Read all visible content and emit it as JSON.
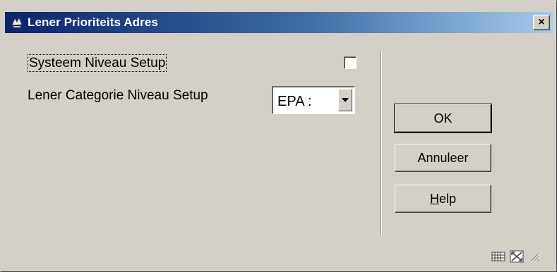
{
  "window": {
    "title": "Lener Prioriteits Adres",
    "close_glyph": "×"
  },
  "form": {
    "system_setup_label": "Systeem Niveau Setup",
    "system_setup_checked": false,
    "category_setup_label": "Lener Categorie Niveau Setup",
    "category_setup_value": "EPA :"
  },
  "buttons": {
    "ok": "OK",
    "cancel": "Annuleer",
    "help_underlined": "H",
    "help_rest": "elp"
  },
  "icons": {
    "app": "library-app-icon",
    "grid": "grid-icon",
    "resize": "resize-icon",
    "grip": "size-grip-icon"
  }
}
